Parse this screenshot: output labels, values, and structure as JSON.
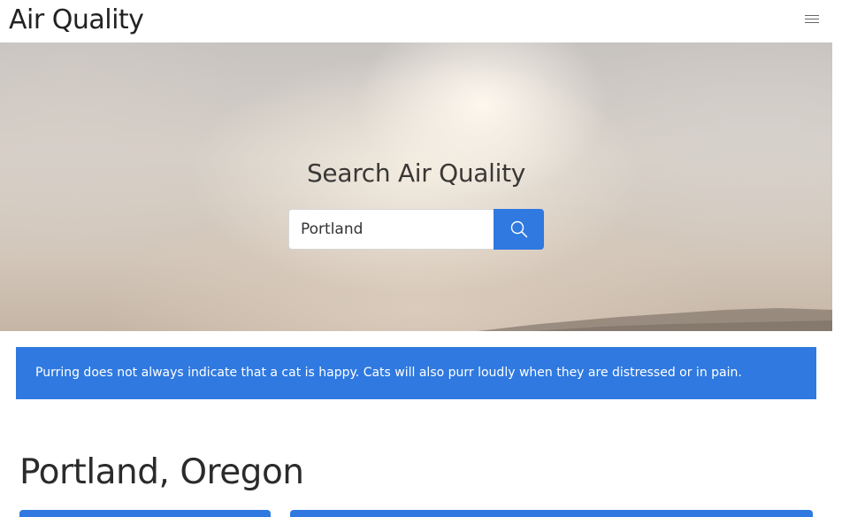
{
  "navbar": {
    "brand": "Air Quality",
    "menu_icon": "hamburger-menu-icon"
  },
  "hero": {
    "title": "Search Air Quality",
    "search": {
      "value": "Portland",
      "placeholder": "",
      "button_icon": "search-icon"
    }
  },
  "fact": {
    "text": "Purring does not always indicate that a cat is happy. Cats will also purr loudly when they are distressed or in pain."
  },
  "result": {
    "city_title": "Portland, Oregon"
  },
  "colors": {
    "accent": "#2f79e0",
    "hero_sky": "#d6cfc7"
  }
}
